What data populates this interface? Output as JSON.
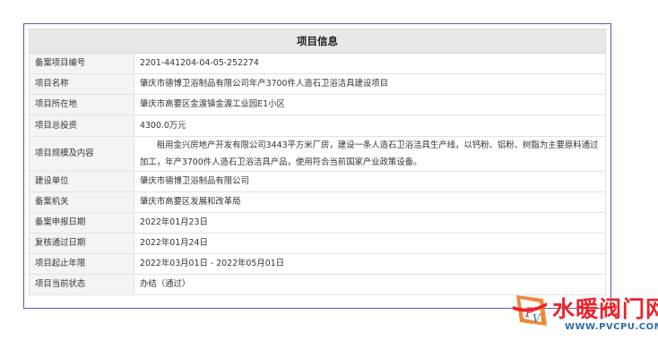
{
  "title": "项目信息",
  "rows": [
    {
      "label": "备案项目编号",
      "value": "2201-441204-04-05-252274"
    },
    {
      "label": "项目名称",
      "value": "肇庆市德博卫浴制品有限公司年产3700件人造石卫浴洁具建设项目"
    },
    {
      "label": "项目所在地",
      "value": "肇庆市高要区金渡镇金渡工业园E1小区"
    },
    {
      "label": "项目总投资",
      "value": "4300.0万元"
    },
    {
      "label": "项目规模及内容",
      "value": "租用金兴房地产开发有限公司3443平方米厂房，建设一条人造石卫浴洁具生产线，以钙粉、铝粉、树脂为主要原料通过加工，年产3700件人造石卫浴洁具产品，使用符合当前国家产业政策设备。"
    },
    {
      "label": "建设单位",
      "value": "肇庆市德博卫浴制品有限公司"
    },
    {
      "label": "备案机关",
      "value": "肇庆市高要区发展和改革局"
    },
    {
      "label": "备案申报日期",
      "value": "2022年01月23日"
    },
    {
      "label": "复核通过日期",
      "value": "2022年01月24日"
    },
    {
      "label": "项目起止年限",
      "value": "2022年03月01日 - 2022年05月01日"
    },
    {
      "label": "项目当前状态",
      "value": "办结（通过）"
    }
  ],
  "watermark": {
    "text": "水暖阀门网",
    "url": "WWW.PVCPU.COM",
    "logo": "pv-logo-icon"
  },
  "colors": {
    "frame_border": "#5a5ab3",
    "label_bg": "#f4f4f4",
    "title_bg": "#e8e8e8",
    "watermark_red": "#e8252c",
    "watermark_blue": "#2f6bb0"
  }
}
